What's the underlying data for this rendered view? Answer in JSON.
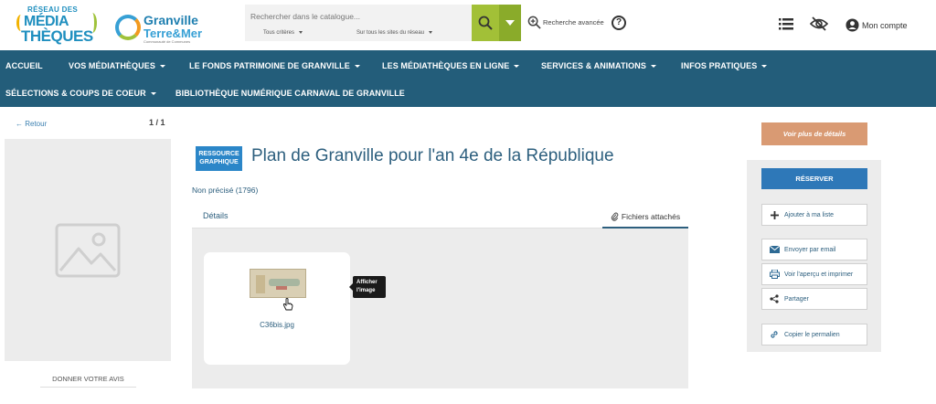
{
  "header": {
    "logo_reseau_top": "RÉSEAU DES",
    "logo_reseau_mid": "MÉDIA",
    "logo_reseau_bot": "THÈQUES",
    "logo_granville_1": "Granville",
    "logo_granville_2": "Terre&Mer",
    "logo_granville_3": "Communauté de Communes",
    "search_placeholder": "Rechercher dans le catalogue...",
    "criteria_label": "Tous critères",
    "scope_label": "Sur tous les sites du réseau",
    "advanced_label": "Recherche avancée",
    "help_label": "?",
    "account_label": "Mon compte"
  },
  "nav": {
    "items_row1": [
      "ACCUEIL",
      "VOS MÉDIATHÈQUES",
      "LE FONDS PATRIMOINE DE GRANVILLE",
      "LES MÉDIATHÈQUES EN LIGNE",
      "SERVICES & ANIMATIONS",
      "INFOS PRATIQUES"
    ],
    "items_row2": [
      "SÉLECTIONS & COUPS DE COEUR",
      "BIBLIOTHÈQUE NUMÉRIQUE CARNAVAL DE GRANVILLE"
    ]
  },
  "left": {
    "back_label": "← Retour",
    "pager": "1 / 1",
    "review_label": "DONNER VOTRE AVIS"
  },
  "record": {
    "badge_line1": "RESSOURCE",
    "badge_line2": "GRAPHIQUE",
    "title": "Plan de Granville pour l'an 4e de la République",
    "sub_info": "Non précisé (1796)",
    "tab_details": "Détails",
    "tab_files": "Fichiers attachés",
    "file_name": "C36bis.jpg",
    "tooltip_line1": "Afficher",
    "tooltip_line2": "l'image"
  },
  "actions": {
    "details_label": "Voir plus de détails",
    "reserve_label": "RÉSERVER",
    "add_list_label": "Ajouter à ma liste",
    "email_label": "Envoyer par email",
    "print_label": "Voir l'aperçu et imprimer",
    "share_label": "Partager",
    "permalink_label": "Copier le permalien"
  },
  "colors": {
    "nav_bg": "#235d7a",
    "search_green": "#a2c037",
    "title_blue": "#2d5f7e",
    "badge_blue": "#2b86c8",
    "details_btn": "#d99a73",
    "reserve_btn": "#2e78b8"
  }
}
